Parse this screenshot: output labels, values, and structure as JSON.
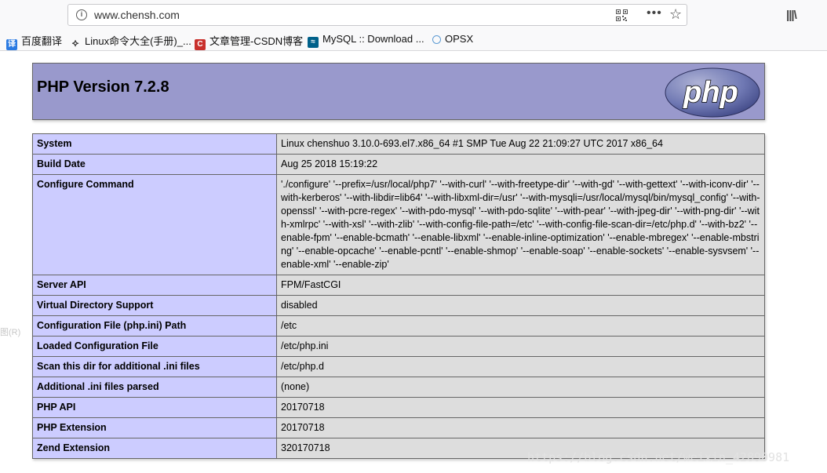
{
  "browser": {
    "url": "www.chensh.com",
    "bookmarks": [
      {
        "label": "百度翻译",
        "icon": "translate-icon",
        "color": "#2a7ae2"
      },
      {
        "label": "Linux命令大全(手册)_...",
        "icon": "linux-icon",
        "color": "#333333"
      },
      {
        "label": "文章管理-CSDN博客",
        "icon": "csdn-icon",
        "color": "#c9302c"
      },
      {
        "label": "MySQL :: Download ...",
        "icon": "mysql-icon",
        "color": "#00618a"
      },
      {
        "label": "OPSX",
        "icon": "globe-icon",
        "color": "#5d9bd3"
      }
    ]
  },
  "header": {
    "title": "PHP Version 7.2.8",
    "logo_text": "php"
  },
  "side_fragment": "图(R)",
  "rows": [
    {
      "label": "System",
      "value": "Linux chenshuo 3.10.0-693.el7.x86_64 #1 SMP Tue Aug 22 21:09:27 UTC 2017 x86_64"
    },
    {
      "label": "Build Date",
      "value": "Aug 25 2018 15:19:22"
    },
    {
      "label": "Configure Command",
      "value": "'./configure' '--prefix=/usr/local/php7' '--with-curl' '--with-freetype-dir' '--with-gd' '--with-gettext' '--with-iconv-dir' '--with-kerberos' '--with-libdir=lib64' '--with-libxml-dir=/usr' '--with-mysqli=/usr/local/mysql/bin/mysql_config' '--with-openssl' '--with-pcre-regex' '--with-pdo-mysql' '--with-pdo-sqlite' '--with-pear' '--with-jpeg-dir' '--with-png-dir' '--with-xmlrpc' '--with-xsl' '--with-zlib' '--with-config-file-path=/etc' '--with-config-file-scan-dir=/etc/php.d' '--with-bz2' '--enable-fpm' '--enable-bcmath' '--enable-libxml' '--enable-inline-optimization' '--enable-mbregex' '--enable-mbstring' '--enable-opcache' '--enable-pcntl' '--enable-shmop' '--enable-soap' '--enable-sockets' '--enable-sysvsem' '--enable-xml' '--enable-zip'"
    },
    {
      "label": "Server API",
      "value": "FPM/FastCGI"
    },
    {
      "label": "Virtual Directory Support",
      "value": "disabled"
    },
    {
      "label": "Configuration File (php.ini) Path",
      "value": "/etc"
    },
    {
      "label": "Loaded Configuration File",
      "value": "/etc/php.ini"
    },
    {
      "label": "Scan this dir for additional .ini files",
      "value": "/etc/php.d"
    },
    {
      "label": "Additional .ini files parsed",
      "value": "(none)"
    },
    {
      "label": "PHP API",
      "value": "20170718"
    },
    {
      "label": "PHP Extension",
      "value": "20170718"
    },
    {
      "label": "Zend Extension",
      "value": "320170718"
    }
  ],
  "watermark": "https://blog.csdn.net/weixin_42890981"
}
